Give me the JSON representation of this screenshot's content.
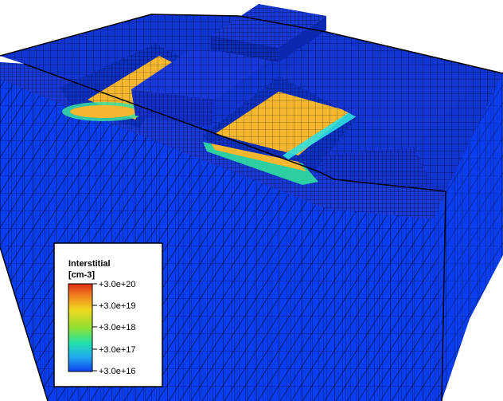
{
  "legend": {
    "title_line1": "Interstitial",
    "title_line2": "[cm-3]",
    "ticks": [
      "+3.0e+20",
      "+3.0e+19",
      "+3.0e+18",
      "+3.0e+17",
      "+3.0e+16"
    ]
  },
  "colors": {
    "substrate": "#0a3df0",
    "top_dark": "#1430c8",
    "mesh_line": "#000000",
    "hot_region": "#f5b630",
    "background": "#ffffff"
  },
  "colorbar_stops": [
    "#e03010",
    "#f07820",
    "#f0d020",
    "#a0e020",
    "#30e0a0",
    "#20b0f0",
    "#1040f0"
  ]
}
